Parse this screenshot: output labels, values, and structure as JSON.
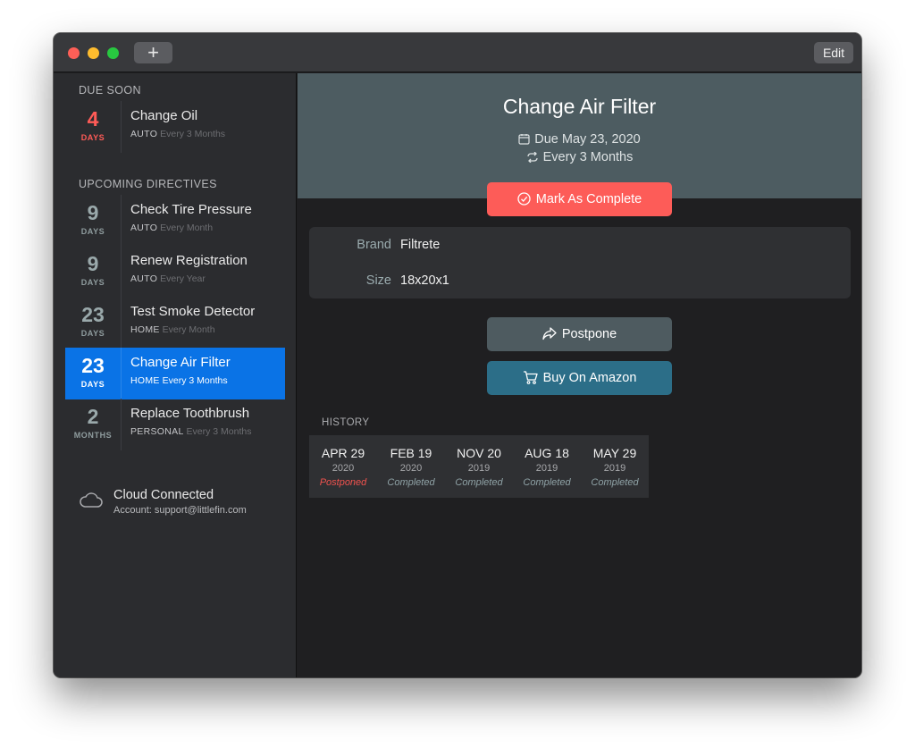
{
  "toolbar": {
    "add_label": "+",
    "edit_label": "Edit"
  },
  "sidebar": {
    "due_soon_header": "DUE SOON",
    "upcoming_header": "UPCOMING DIRECTIVES",
    "items": [
      {
        "count": "4",
        "unit": "DAYS",
        "title": "Change Oil",
        "category": "AUTO",
        "frequency": "Every 3 Months",
        "state": "overdue"
      },
      {
        "count": "9",
        "unit": "DAYS",
        "title": "Check Tire Pressure",
        "category": "AUTO",
        "frequency": "Every Month",
        "state": "normal"
      },
      {
        "count": "9",
        "unit": "DAYS",
        "title": "Renew Registration",
        "category": "AUTO",
        "frequency": "Every Year",
        "state": "normal"
      },
      {
        "count": "23",
        "unit": "DAYS",
        "title": "Test Smoke Detector",
        "category": "HOME",
        "frequency": "Every Month",
        "state": "normal"
      },
      {
        "count": "23",
        "unit": "DAYS",
        "title": "Change Air Filter",
        "category": "HOME",
        "frequency": "Every 3 Months",
        "state": "selected"
      },
      {
        "count": "2",
        "unit": "MONTHS",
        "title": "Replace Toothbrush",
        "category": "PERSONAL",
        "frequency": "Every 3 Months",
        "state": "normal"
      }
    ],
    "cloud": {
      "status": "Cloud Connected",
      "account": "Account: support@littlefin.com"
    }
  },
  "detail": {
    "title": "Change Air Filter",
    "due": "Due May 23, 2020",
    "repeat": "Every 3 Months",
    "mark_complete_label": "Mark As Complete",
    "fields": [
      {
        "label": "Brand",
        "value": "Filtrete"
      },
      {
        "label": "Size",
        "value": "18x20x1"
      }
    ],
    "postpone_label": "Postpone",
    "amazon_label": "Buy On Amazon",
    "history_header": "HISTORY",
    "history": [
      {
        "date": "APR 29",
        "year": "2020",
        "status": "Postponed"
      },
      {
        "date": "FEB 19",
        "year": "2020",
        "status": "Completed"
      },
      {
        "date": "NOV 20",
        "year": "2019",
        "status": "Completed"
      },
      {
        "date": "AUG 18",
        "year": "2019",
        "status": "Completed"
      },
      {
        "date": "MAY 29",
        "year": "2019",
        "status": "Completed"
      }
    ]
  },
  "icons": {
    "calendar": "calendar-icon",
    "repeat": "repeat-icon",
    "check": "check-circle-icon",
    "postpone": "share-arrow-icon",
    "cart": "cart-icon",
    "cloud": "cloud-icon"
  },
  "colors": {
    "overdue": "#ff5b57",
    "selected": "#0a73e6",
    "mark_complete": "#fd5c58",
    "amazon": "#2c6e88",
    "header": "#4d5c61"
  }
}
